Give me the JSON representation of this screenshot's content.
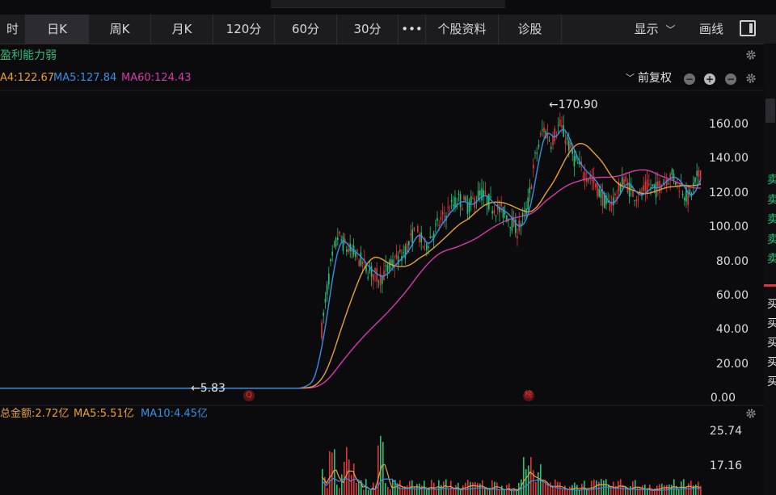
{
  "toolbar": {
    "tabs": [
      {
        "label": "时"
      },
      {
        "label": "日K"
      },
      {
        "label": "周K"
      },
      {
        "label": "月K"
      },
      {
        "label": "120分"
      },
      {
        "label": "60分"
      },
      {
        "label": "30分"
      },
      {
        "label": "•••"
      },
      {
        "label": "个股资料"
      },
      {
        "label": "诊股"
      }
    ],
    "display_label": "显示",
    "draw_label": "画线"
  },
  "indicator": {
    "label": "盈利能力弱"
  },
  "ma": {
    "ma_a": "A4:122.67",
    "ma5": "MA5:127.84",
    "ma60": "MA60:124.43",
    "adjust_label": "前复权"
  },
  "price_axis": [
    "160.00",
    "140.00",
    "120.00",
    "100.00",
    "80.00",
    "60.00",
    "40.00",
    "20.00",
    "0.00"
  ],
  "annotations": {
    "high": "←170.90",
    "low": "←5.83",
    "marker_q": "Q",
    "marker_list": "榜"
  },
  "amount": {
    "total": "总金额:2.72亿",
    "ma5": "MA5:5.51亿",
    "ma10": "MA10:4.45亿",
    "axis": [
      "25.74",
      "17.16"
    ]
  },
  "right_panel_chars": [
    "卖",
    "卖",
    "卖",
    "卖",
    "卖",
    "买",
    "买",
    "买",
    "买",
    "买"
  ],
  "colors": {
    "up": "#e2353a",
    "down": "#27c37a",
    "ma5": "#3a8ee6",
    "ma_orange": "#e8a13a",
    "ma60": "#d63aa8"
  }
}
